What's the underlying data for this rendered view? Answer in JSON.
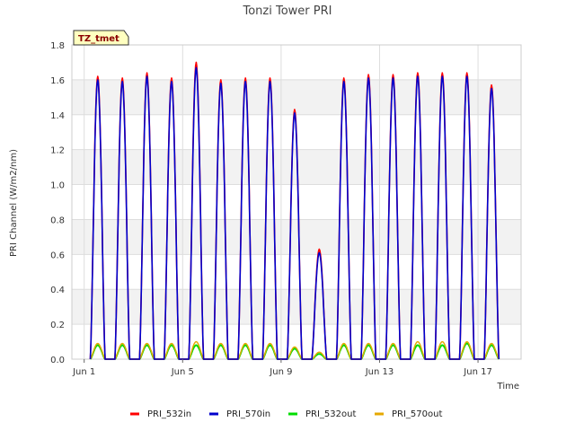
{
  "chart_data": {
    "type": "line",
    "title": "Tonzi Tower PRI",
    "xlabel": "Time",
    "ylabel": "PRI Channel (W/m2/nm)",
    "ylim": [
      0,
      1.8
    ],
    "xlim": [
      0.5,
      18.75
    ],
    "x_unit": "day of June",
    "y_ticks": [
      "0.0",
      "0.2",
      "0.4",
      "0.6",
      "0.8",
      "1.0",
      "1.2",
      "1.4",
      "1.6",
      "1.8"
    ],
    "x_ticks": [
      {
        "day": 1,
        "label": "Jun 1"
      },
      {
        "day": 5,
        "label": "Jun 5"
      },
      {
        "day": 9,
        "label": "Jun 9"
      },
      {
        "day": 13,
        "label": "Jun 13"
      },
      {
        "day": 17,
        "label": "Jun 17"
      }
    ],
    "grid": true,
    "legend_position": "bottom",
    "annotation": "TZ_tmet",
    "daily_peak_time_fraction": 0.55,
    "series": [
      {
        "name": "PRI_532in",
        "color": "#ff0000",
        "daily_peaks": [
          1.62,
          1.61,
          1.64,
          1.61,
          1.7,
          1.6,
          1.61,
          1.61,
          1.43,
          0.63,
          1.61,
          1.63,
          1.63,
          1.64,
          1.64,
          1.64,
          1.57
        ]
      },
      {
        "name": "PRI_570in",
        "color": "#0000cc",
        "daily_peaks": [
          1.6,
          1.59,
          1.62,
          1.59,
          1.67,
          1.58,
          1.59,
          1.59,
          1.41,
          0.61,
          1.59,
          1.61,
          1.61,
          1.62,
          1.62,
          1.62,
          1.55
        ]
      },
      {
        "name": "PRI_532out",
        "color": "#00dd00",
        "daily_peaks": [
          0.08,
          0.08,
          0.08,
          0.08,
          0.08,
          0.08,
          0.08,
          0.08,
          0.06,
          0.03,
          0.08,
          0.08,
          0.08,
          0.08,
          0.08,
          0.09,
          0.08
        ]
      },
      {
        "name": "PRI_570out",
        "color": "#e6a800",
        "daily_peaks": [
          0.09,
          0.09,
          0.09,
          0.09,
          0.1,
          0.09,
          0.09,
          0.09,
          0.07,
          0.04,
          0.09,
          0.09,
          0.09,
          0.1,
          0.1,
          0.1,
          0.09
        ]
      }
    ]
  }
}
